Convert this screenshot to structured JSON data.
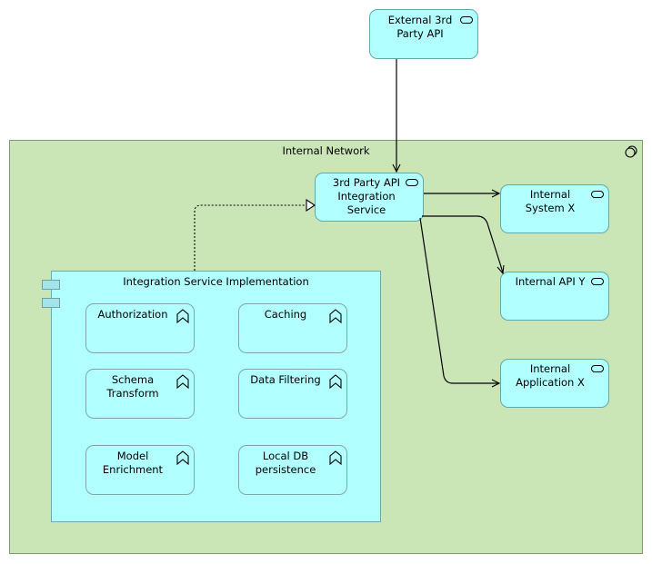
{
  "diagram": {
    "network": {
      "label": "Internal Network",
      "icon": "network-node-icon"
    },
    "external_api": {
      "label": "External 3rd\nParty API",
      "icon": "service-icon"
    },
    "integration_service": {
      "label": "3rd Party API\nIntegration\nService",
      "icon": "service-icon"
    },
    "internal_services": [
      {
        "label": "Internal\nSystem X",
        "icon": "service-icon"
      },
      {
        "label": "Internal API Y",
        "icon": "service-icon"
      },
      {
        "label": "Internal\nApplication X",
        "icon": "service-icon"
      }
    ],
    "component": {
      "label": "Integration Service Implementation",
      "icon": "component-icon",
      "functions": [
        {
          "label": "Authorization",
          "icon": "function-icon"
        },
        {
          "label": "Caching",
          "icon": "function-icon"
        },
        {
          "label": "Schema\nTransform",
          "icon": "function-icon"
        },
        {
          "label": "Data Filtering",
          "icon": "function-icon"
        },
        {
          "label": "Model\nEnrichment",
          "icon": "function-icon"
        },
        {
          "label": "Local DB\npersistence",
          "icon": "function-icon"
        }
      ]
    },
    "relations": [
      {
        "from": "External 3rd Party API",
        "to": "3rd Party API Integration Service",
        "type": "flow"
      },
      {
        "from": "Integration Service Implementation",
        "to": "3rd Party API Integration Service",
        "type": "realization"
      },
      {
        "from": "3rd Party API Integration Service",
        "to": "Internal System X",
        "type": "flow"
      },
      {
        "from": "3rd Party API Integration Service",
        "to": "Internal API Y",
        "type": "flow"
      },
      {
        "from": "3rd Party API Integration Service",
        "to": "Internal Application X",
        "type": "flow"
      }
    ],
    "colors": {
      "network_fill": "#cae6b7",
      "service_fill": "#b2ffff",
      "component_tab": "#a3e3ea"
    }
  }
}
